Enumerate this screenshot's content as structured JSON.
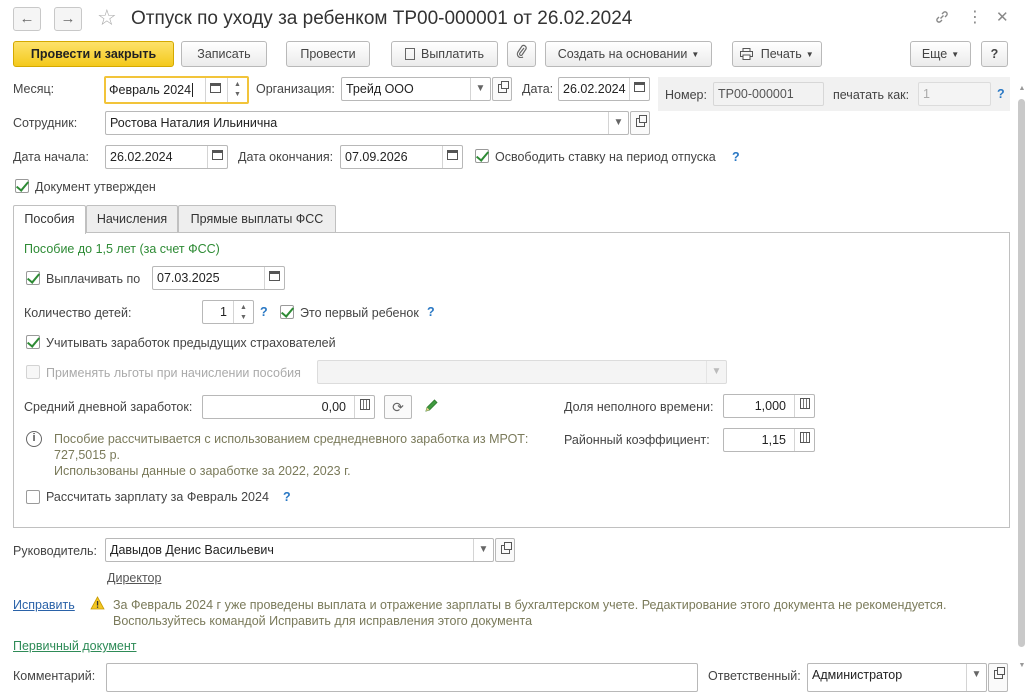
{
  "title": "Отпуск по уходу за ребенком ТР00-000001 от 26.02.2024",
  "toolbar": {
    "post_and_close": "Провести и закрыть",
    "save": "Записать",
    "post": "Провести",
    "pay": "Выплатить",
    "create_based": "Создать на основании",
    "print": "Печать",
    "more": "Еще",
    "help": "?"
  },
  "header": {
    "month_label": "Месяц:",
    "month_value": "Февраль 2024",
    "org_label": "Организация:",
    "org_value": "Трейд ООО",
    "date_label": "Дата:",
    "date_value": "26.02.2024",
    "number_label": "Номер:",
    "number_value": "ТР00-000001",
    "print_as_label": "печатать как:",
    "print_as_placeholder": "1",
    "employee_label": "Сотрудник:",
    "employee_value": "Ростова Наталия Ильинична",
    "start_label": "Дата начала:",
    "start_value": "26.02.2024",
    "end_label": "Дата окончания:",
    "end_value": "07.09.2026",
    "free_rate_label": "Освободить ставку на период отпуска",
    "approved_label": "Документ утвержден",
    "help_mark": "?"
  },
  "tabs": [
    "Пособия",
    "Начисления",
    "Прямые выплаты ФСС"
  ],
  "benefits": {
    "section_title": "Пособие до 1,5 лет (за счет ФСС)",
    "pay_until_label": "Выплачивать по",
    "pay_until_value": "07.03.2025",
    "children_label": "Количество детей:",
    "children_value": "1",
    "first_child_label": "Это первый ребенок",
    "prev_insurers_label": "Учитывать заработок предыдущих страхователей",
    "privileges_label": "Применять льготы при начислении пособия",
    "avg_earnings_label": "Средний дневной заработок:",
    "avg_earnings_value": "0,00",
    "part_time_label": "Доля неполного времени:",
    "part_time_value": "1,000",
    "regional_coef_label": "Районный коэффициент:",
    "regional_coef_value": "1,15",
    "info_line1": "Пособие рассчитывается с использованием среднедневного заработка из МРОТ:",
    "info_line2": "727,5015 р.",
    "info_line3": "Использованы данные о заработке за  2022,  2023 г.",
    "calc_salary_label": "Рассчитать зарплату за Февраль 2024"
  },
  "footer": {
    "manager_label": "Руководитель:",
    "manager_value": "Давыдов Денис Васильевич",
    "manager_position": "Директор",
    "fix_link": "Исправить",
    "warning_line1": "За Февраль 2024 г уже проведены выплата и отражение зарплаты в бухгалтерском учете. Редактирование этого документа не рекомендуется.",
    "warning_line2": "Воспользуйтесь командой Исправить для исправления этого документа",
    "primary_doc_link": "Первичный документ",
    "comment_label": "Комментарий:",
    "comment_value": "",
    "responsible_label": "Ответственный:",
    "responsible_value": "Администратор"
  },
  "colors": {
    "primary_button": "#f4c91c",
    "check_green": "#2e8b35",
    "link_blue": "#2a62a8",
    "link_green": "#2e8b57",
    "section_green": "#2e8b35",
    "warning_yellow": "#e6b800"
  }
}
